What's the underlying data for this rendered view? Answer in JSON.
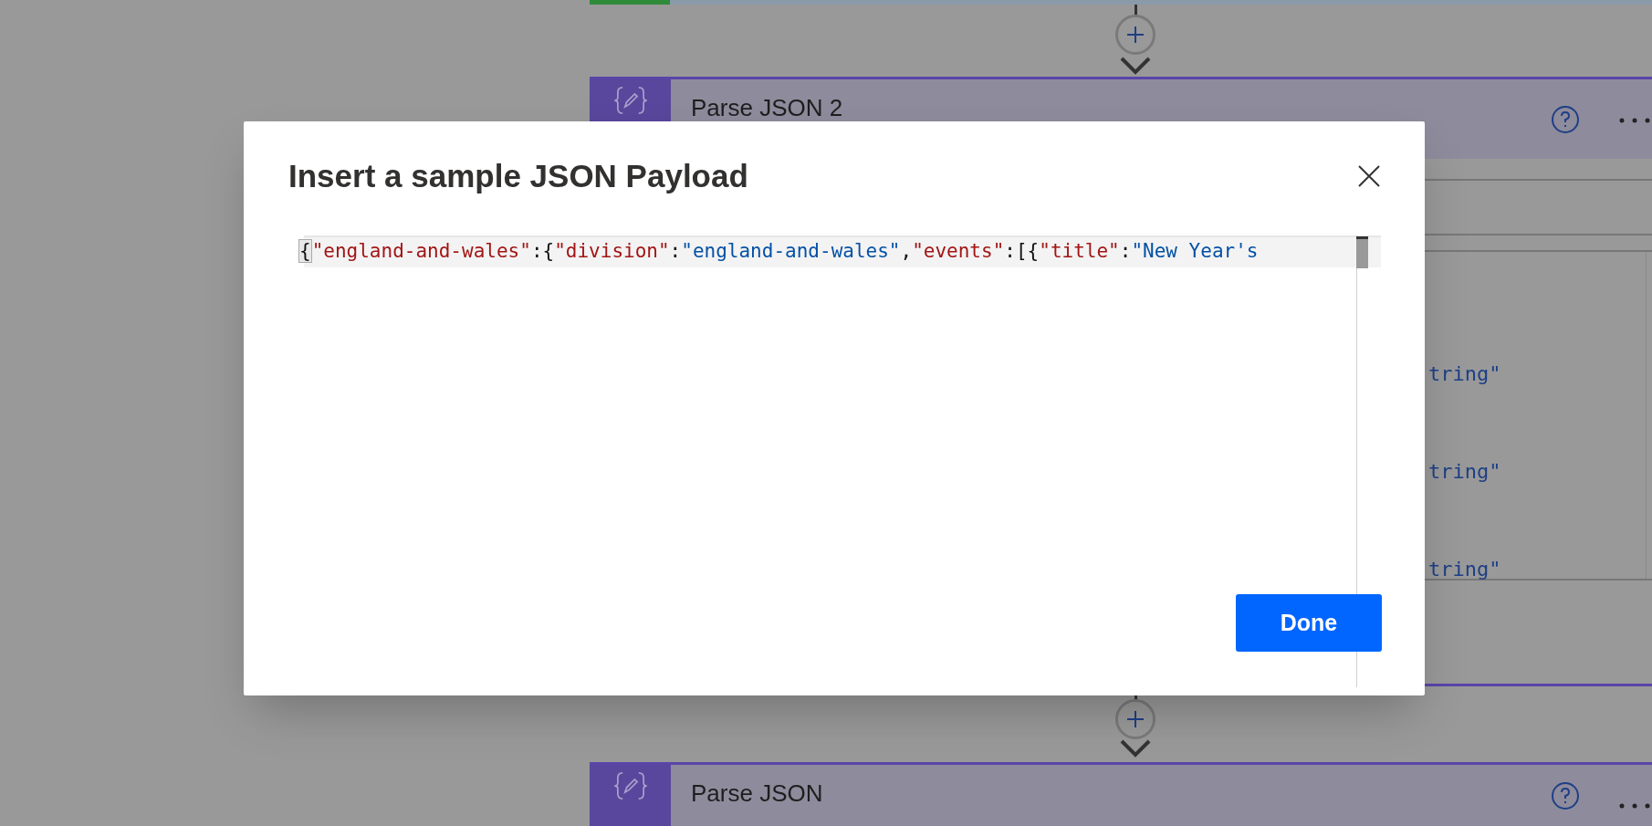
{
  "background": {
    "cards": [
      {
        "title": "Parse JSON 2",
        "body_lines": [
          "tring\"",
          "tring\"",
          "tring\""
        ]
      },
      {
        "title": "Parse JSON"
      }
    ]
  },
  "modal": {
    "title": "Insert a sample JSON Payload",
    "editor_tokens": [
      {
        "kind": "punct",
        "text": "{"
      },
      {
        "kind": "key",
        "text": "\"england-and-wales\""
      },
      {
        "kind": "punct",
        "text": ":{"
      },
      {
        "kind": "key",
        "text": "\"division\""
      },
      {
        "kind": "punct",
        "text": ":"
      },
      {
        "kind": "string",
        "text": "\"england-and-wales\""
      },
      {
        "kind": "punct",
        "text": ","
      },
      {
        "kind": "key",
        "text": "\"events\""
      },
      {
        "kind": "punct",
        "text": ":[{"
      },
      {
        "kind": "key",
        "text": "\"title\""
      },
      {
        "kind": "punct",
        "text": ":"
      },
      {
        "kind": "string",
        "text": "\"New Year's"
      }
    ],
    "button": "Done"
  }
}
